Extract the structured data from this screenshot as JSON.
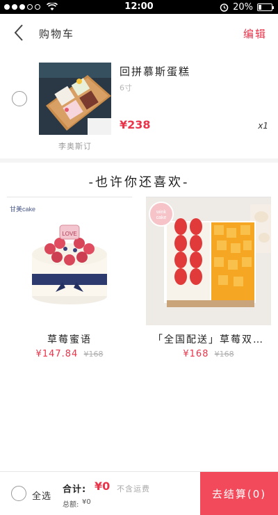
{
  "status_bar": {
    "time": "12:00",
    "battery": "20%",
    "battery_level": 0.2
  },
  "header": {
    "title": "购物车",
    "edit": "编辑"
  },
  "cart": {
    "item": {
      "name": "回拼慕斯蛋糕",
      "spec": "6寸",
      "price": "¥238",
      "quantity": "x1",
      "shop": "李奥斯订"
    }
  },
  "recommend": {
    "title": "-也许你还喜欢-",
    "products": [
      {
        "name": "草莓蜜语",
        "price": "¥147.84",
        "old_price": "¥168"
      },
      {
        "name": "「全国配送」草莓双…",
        "price": "¥168",
        "old_price": "¥168"
      }
    ],
    "brand_marks": [
      "甘美cake",
      "winkcake"
    ]
  },
  "footer": {
    "select_all": "全选",
    "total_label": "合计:",
    "total_value": "¥0",
    "shipping_note": "不含运费",
    "discount_label": "总额:",
    "discount_value": "¥0",
    "checkout": "去结算(0)"
  },
  "colors": {
    "accent": "#e9344a",
    "checkout_bg": "#f24a5a",
    "status_bar_bg": "#000000"
  },
  "icons": {
    "back": "chevron-left-icon",
    "alarm": "alarm-icon",
    "wifi": "wifi-icon",
    "signal": "signal-dots-icon"
  }
}
